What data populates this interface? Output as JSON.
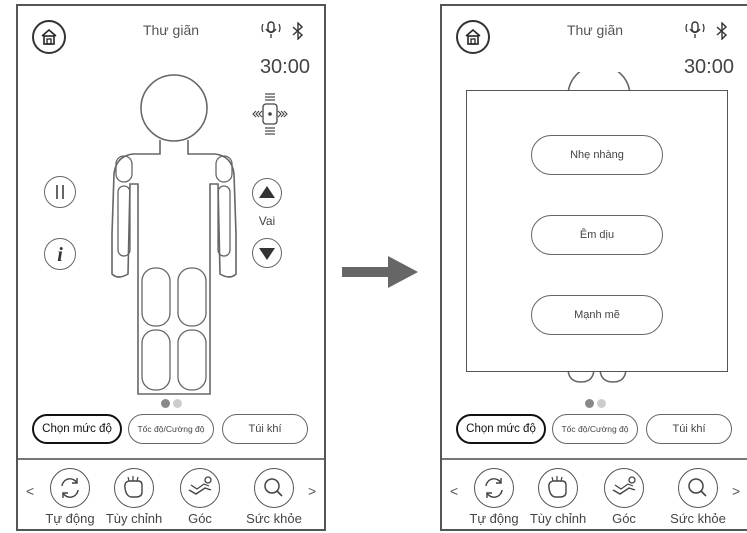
{
  "left_screen": {
    "title": "Thư giãn",
    "timer": "30:00",
    "zone_label": "Vai",
    "mode_buttons": [
      "Chọn mức độ",
      "Tốc độ/Cường độ",
      "Túi khí"
    ],
    "nav_items": [
      "Tự động",
      "Tùy chỉnh",
      "Góc",
      "Sức khỏe"
    ],
    "page_indicator": {
      "active": 1,
      "total": 2
    },
    "icons": [
      "home-icon",
      "voice-icon",
      "bluetooth-icon",
      "direction-cross-icon",
      "pause-icon",
      "info-icon",
      "up-arrow-icon",
      "down-arrow-icon",
      "chevron-left-icon",
      "chevron-right-icon"
    ]
  },
  "right_screen": {
    "title": "Thư giãn",
    "timer": "30:00",
    "intensity_options": [
      "Nhẹ nhàng",
      "Êm dịu",
      "Mạnh mẽ"
    ],
    "mode_buttons": [
      "Chọn mức độ",
      "Tốc độ/Cường độ",
      "Túi khí"
    ],
    "nav_items": [
      "Tự động",
      "Tùy chỉnh",
      "Góc",
      "Sức khỏe"
    ],
    "page_indicator": {
      "active": 1,
      "total": 2
    }
  },
  "colors": {
    "outline": "#555555",
    "active_dot": "#888888",
    "inactive_dot": "#cccccc",
    "arrow": "#666666"
  }
}
